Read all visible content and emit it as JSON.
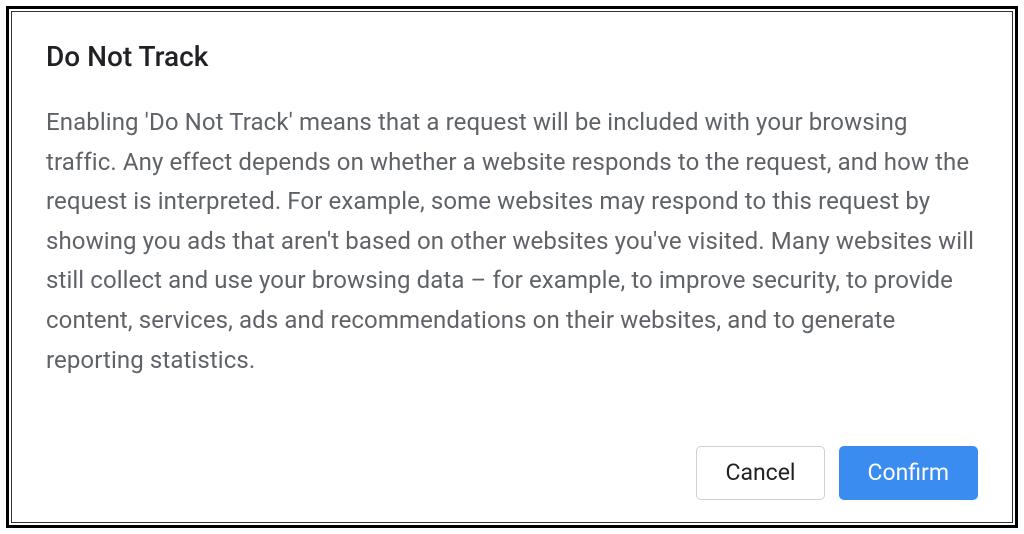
{
  "dialog": {
    "title": "Do Not Track",
    "body": "Enabling 'Do Not Track' means that a request will be included with your browsing traffic. Any effect depends on whether a website responds to the request, and how the request is interpreted. For example, some websites may respond to this request by showing you ads that aren't based on other websites you've visited. Many websites will still collect and use your browsing data – for example, to improve security, to provide content, services, ads and recommendations on their websites, and to generate reporting statistics.",
    "cancel_label": "Cancel",
    "confirm_label": "Confirm"
  }
}
